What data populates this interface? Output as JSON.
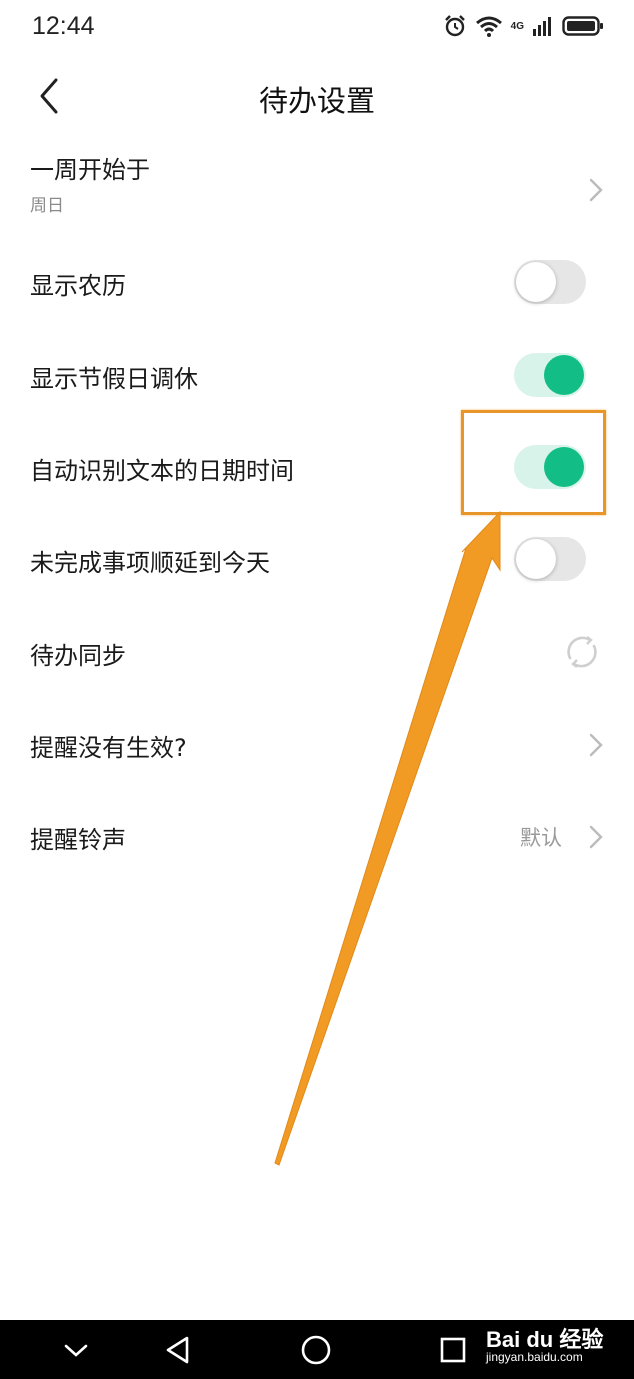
{
  "status_bar": {
    "time": "12:44",
    "network_label": "4G",
    "icons": [
      "alarm-icon",
      "wifi-icon",
      "signal-icon",
      "battery-icon"
    ]
  },
  "header": {
    "title": "待办设置",
    "back_icon": "back-arrow-icon"
  },
  "settings": {
    "week_start": {
      "title": "一周开始于",
      "value": "周日"
    },
    "lunar": {
      "title": "显示农历",
      "enabled": false
    },
    "holiday": {
      "title": "显示节假日调休",
      "enabled": true
    },
    "auto_detect": {
      "title": "自动识别文本的日期时间",
      "enabled": true
    },
    "postpone": {
      "title": "未完成事项顺延到今天",
      "enabled": false
    },
    "sync": {
      "title": "待办同步",
      "icon": "sync-icon"
    },
    "reminder_issue": {
      "title": "提醒没有生效?"
    },
    "ringtone": {
      "title": "提醒铃声",
      "value": "默认"
    }
  },
  "colors": {
    "toggle_on": "#12be85",
    "toggle_on_track": "#d7f3ea",
    "toggle_off_track": "#e6e6e6",
    "annotation": "#e8962a"
  },
  "watermark": {
    "brand": "Bai du 经验",
    "url": "jingyan.baidu.com"
  },
  "nav_bar": {
    "icons": [
      "collapse-down-icon",
      "back-triangle-icon",
      "home-circle-icon",
      "recents-square-icon"
    ]
  }
}
